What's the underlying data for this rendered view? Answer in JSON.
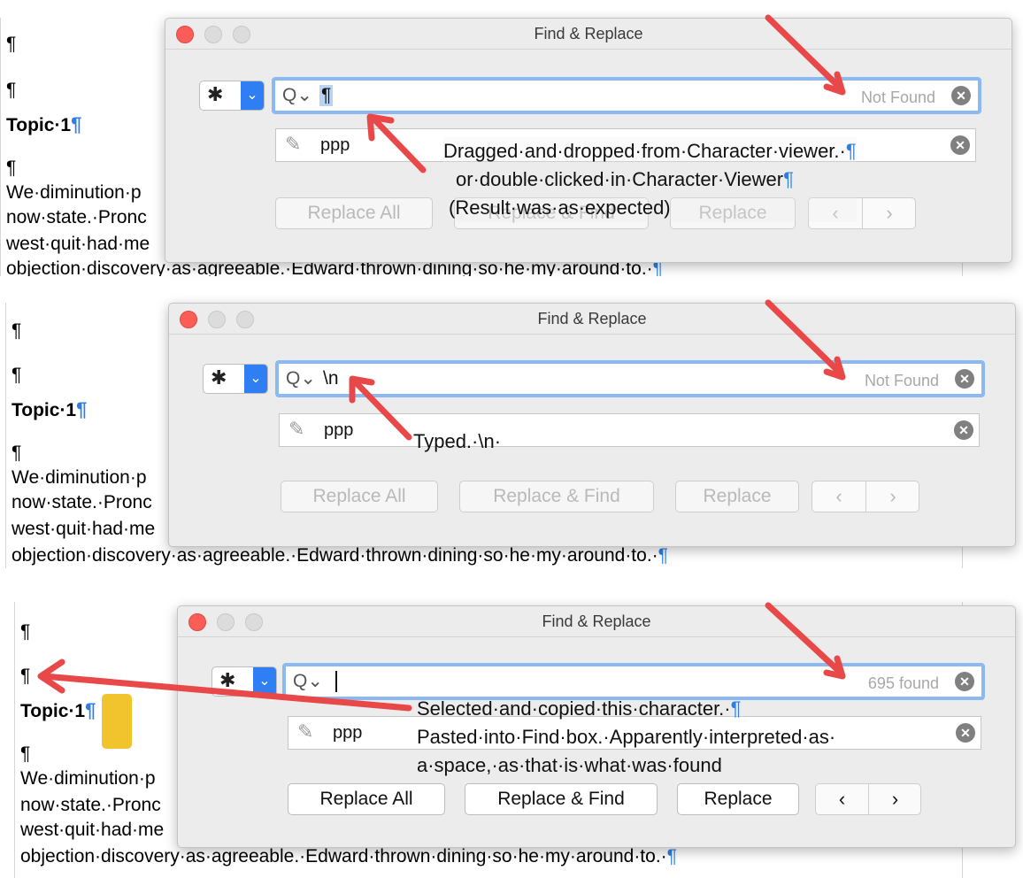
{
  "window_title": "Find & Replace",
  "icons": {
    "gear": "gear-icon",
    "dropdown": "chevron-down-icon",
    "search": "magnifier-icon",
    "clear": "clear-x-icon",
    "pencil": "pencil-icon",
    "prev": "chevron-left-icon",
    "next": "chevron-right-icon"
  },
  "colors": {
    "accent": "#2f7ef3",
    "find_border": "#8cb9f2",
    "annotation_arrow": "#e94848",
    "pilcrow": "#2f7fe0",
    "highlight": "#f1c42e"
  },
  "document": {
    "pilcrow": "¶",
    "heading": "Topic·1",
    "line1": "We·diminution·p",
    "line2": "now·state.·Pronc",
    "line3": "west·quit·had·me",
    "line4": "objection·discovery·as·agreeable.·Edward·thrown·dining·so·he·my·around·to.·"
  },
  "panels": [
    {
      "find_value": "¶",
      "status": "Not Found",
      "replace_value": "ppp",
      "buttons": {
        "replace_all": "Replace All",
        "replace_find": "Replace & Find",
        "replace": "Replace"
      },
      "buttons_enabled": false,
      "annotation": [
        "Dragged·and·dropped·from·Character·viewer.·",
        "or·double·clicked·in·Character·Viewer",
        "(Result·was·as·expected)"
      ]
    },
    {
      "find_value": "\\n",
      "status": "Not Found",
      "replace_value": "ppp",
      "buttons": {
        "replace_all": "Replace All",
        "replace_find": "Replace & Find",
        "replace": "Replace"
      },
      "buttons_enabled": false,
      "annotation": [
        "Typed.·\\n·"
      ]
    },
    {
      "find_value": "",
      "status": "695 found",
      "replace_value": "ppp",
      "buttons": {
        "replace_all": "Replace All",
        "replace_find": "Replace & Find",
        "replace": "Replace"
      },
      "buttons_enabled": true,
      "annotation": [
        "Selected·and·copied·this·character.·",
        "Pasted·into·Find·box.·Apparently·interpreted·as·",
        "a·space,·as·that·is·what·was·found"
      ]
    }
  ]
}
